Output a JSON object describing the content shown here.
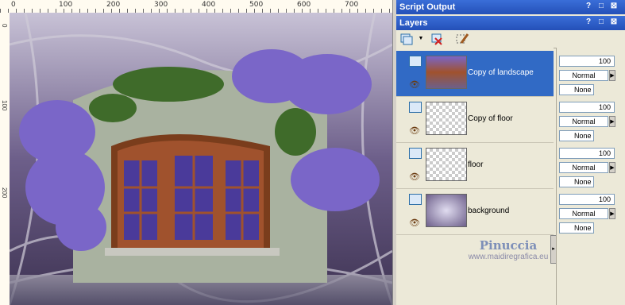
{
  "ruler": {
    "ticks": [
      "0",
      "100",
      "200",
      "300",
      "400",
      "500",
      "600",
      "700"
    ],
    "left_labels": [
      "0",
      "100",
      "200"
    ]
  },
  "script_output": {
    "title": "Script Output",
    "controls": [
      "?",
      "□",
      "⊠"
    ]
  },
  "layers_panel": {
    "title": "Layers",
    "controls": [
      "?",
      "□",
      "⊠"
    ],
    "toolbar": [
      "layer-dropdown-icon",
      "delete-layer-icon",
      "edit-icon"
    ],
    "layers": [
      {
        "name": "Copy of landscape",
        "opacity": "100",
        "blend": "Normal",
        "mask": "None",
        "selected": true
      },
      {
        "name": "Copy of floor",
        "opacity": "100",
        "blend": "Normal",
        "mask": "None",
        "selected": false
      },
      {
        "name": "floor",
        "opacity": "100",
        "blend": "Normal",
        "mask": "None",
        "selected": false
      },
      {
        "name": "background",
        "opacity": "100",
        "blend": "Normal",
        "mask": "None",
        "selected": false
      }
    ]
  },
  "watermark": {
    "name": "Pinuccia",
    "url": "www.maidiregrafica.eu"
  },
  "colors": {
    "selected": "#316ac5",
    "title_bar": "#2450b8",
    "wisteria": "#7a66c8",
    "door": "#a0522d"
  }
}
